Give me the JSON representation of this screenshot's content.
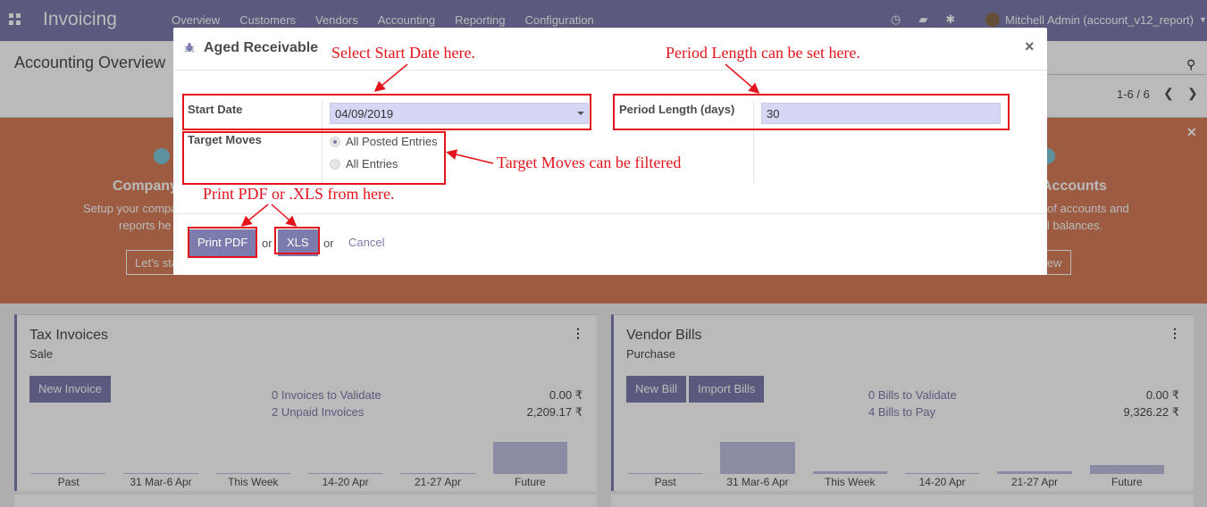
{
  "app": {
    "brand": "Invoicing",
    "menu": [
      "Overview",
      "Customers",
      "Vendors",
      "Accounting",
      "Reporting",
      "Configuration"
    ],
    "user": "Mitchell Admin (account_v12_report)",
    "breadcrumb": "Accounting Overview",
    "pager": "1-6 / 6"
  },
  "banner": {
    "left_title": "Company",
    "left_text_1": "Setup your compa",
    "left_text_2": "reports he",
    "left_button": "Let's sta",
    "right_title": "Accounts",
    "right_text_1": "of accounts and",
    "right_text_2": "l balances.",
    "right_button": "iew"
  },
  "cards": [
    {
      "title": "Tax Invoices",
      "subtitle": "Sale",
      "buttons": [
        "New Invoice"
      ],
      "links": [
        "0 Invoices to Validate",
        "2 Unpaid Invoices"
      ],
      "amounts": [
        "0.00 ₹",
        "2,209.17 ₹"
      ],
      "bars": {
        "labels": [
          "Past",
          "31 Mar-6 Apr",
          "This Week",
          "14-20 Apr",
          "21-27 Apr",
          "Future"
        ],
        "levels": [
          0.02,
          0.02,
          0.02,
          0.02,
          0.02,
          1.0
        ]
      }
    },
    {
      "title": "Vendor Bills",
      "subtitle": "Purchase",
      "buttons": [
        "New Bill",
        "Import Bills"
      ],
      "links": [
        "0 Bills to Validate",
        "4 Bills to Pay"
      ],
      "amounts": [
        "0.00 ₹",
        "9,326.22 ₹"
      ],
      "bars": {
        "labels": [
          "Past",
          "31 Mar-6 Apr",
          "This Week",
          "14-20 Apr",
          "21-27 Apr",
          "Future"
        ],
        "levels": [
          0.02,
          1.0,
          0.08,
          0.02,
          0.08,
          0.28
        ]
      }
    }
  ],
  "modal": {
    "title": "Aged Receivable",
    "close": "×",
    "start_date_label": "Start Date",
    "start_date_value": "04/09/2019",
    "period_length_label": "Period Length (days)",
    "period_length_value": "30",
    "target_moves_label": "Target Moves",
    "target_moves_options": [
      "All Posted Entries",
      "All Entries"
    ],
    "target_moves_selected": "All Posted Entries",
    "btn_pdf": "Print PDF",
    "or_1": "or",
    "btn_xls": "XLS",
    "or_2": "or",
    "cancel": "Cancel"
  },
  "annotations": {
    "start_date": "Select Start Date here.",
    "period_length": "Period Length can be set here.",
    "target_moves": "Target Moves can be filtered",
    "print": "Print PDF or .XLS from here."
  },
  "colors": {
    "navbar": "#7c7bad",
    "banner": "#d77f5b",
    "annotation": "#e3141b",
    "input_bg": "#d6d6f5"
  }
}
